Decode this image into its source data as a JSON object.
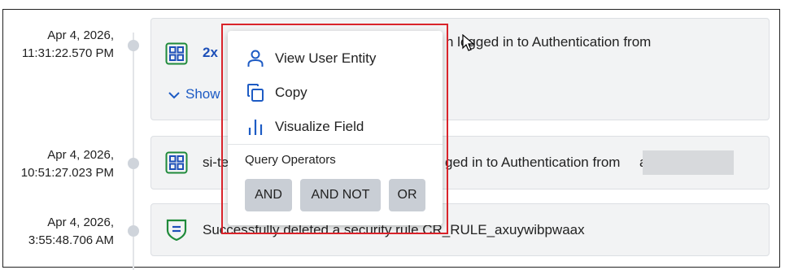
{
  "events": [
    {
      "date": "Apr 4, 2026,",
      "time": "11:31:22.570 PM",
      "icon": "grid-app-icon",
      "count": "2x",
      "text": "n logged in to Authentication from",
      "show_label": "Show"
    },
    {
      "date": "Apr 4, 2026,",
      "time": "10:51:27.023 PM",
      "icon": "grid-app-icon",
      "text_prefix": "si-te",
      "text": "ged in to Authentication from",
      "text_tail": "a"
    },
    {
      "date": "Apr 4, 2026,",
      "time": "3:55:48.706 AM",
      "icon": "shield-icon",
      "text": "Successfully deleted a security rule CR_RULE_axuywibpwaax"
    }
  ],
  "context_menu": {
    "items": [
      {
        "label": "View User Entity",
        "icon": "user-icon"
      },
      {
        "label": "Copy",
        "icon": "copy-icon"
      },
      {
        "label": "Visualize Field",
        "icon": "bar-chart-icon"
      }
    ],
    "section_title": "Query Operators",
    "operators": [
      "AND",
      "AND NOT",
      "OR"
    ]
  },
  "colors": {
    "highlight": "#d9232a",
    "link": "#1d5bc4",
    "icon_green": "#1f8a3a",
    "icon_blue": "#1d4fb8"
  }
}
